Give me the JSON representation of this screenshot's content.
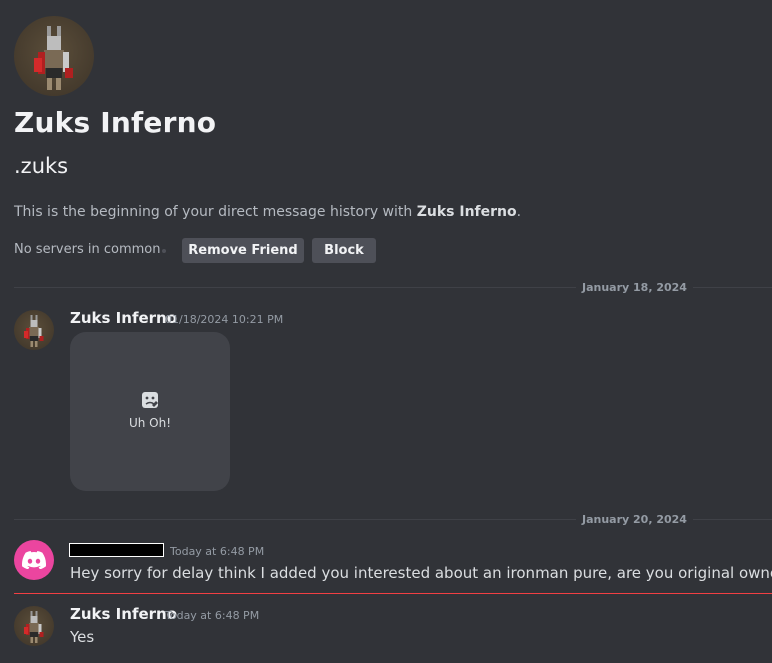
{
  "intro": {
    "name": "Zuks Inferno",
    "handle": ".zuks",
    "beginning_text": "This is the beginning of your direct message history with ",
    "beginning_name": "Zuks Inferno",
    "beginning_end": ".",
    "servers_text": "No servers in common",
    "remove_friend_label": "Remove Friend",
    "block_label": "Block"
  },
  "dividers": {
    "first": "January 18, 2024",
    "second": "January 20, 2024"
  },
  "messages": [
    {
      "author": "Zuks Inferno",
      "timestamp": "01/18/2024 10:21 PM",
      "attachment_label": "Uh Oh!"
    },
    {
      "author": "",
      "timestamp": "Today at 6:48 PM",
      "text": "Hey sorry for delay think I added you interested about an ironman pure, are you original owner?"
    },
    {
      "author": "Zuks Inferno",
      "timestamp": "Today at 6:48 PM",
      "text": "Yes"
    }
  ],
  "icons": {
    "avatar": "character-avatar",
    "broken_image": "broken-image-icon",
    "discord": "discord-logo-icon"
  },
  "colors": {
    "background": "#313338",
    "button": "#4e5058",
    "discord_avatar": "#eb459f",
    "new_message_line": "#f23f43"
  }
}
